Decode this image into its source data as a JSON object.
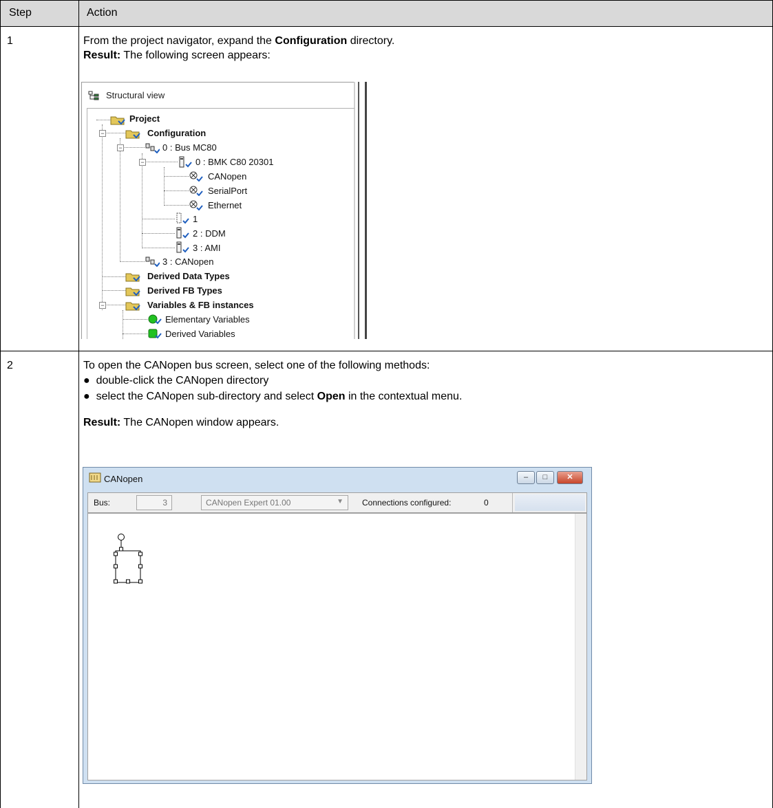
{
  "table": {
    "headers": {
      "step": "Step",
      "action": "Action"
    },
    "rows": [
      {
        "step": "1",
        "line1": {
          "pre": "From the project navigator, expand the ",
          "bold": "Configuration",
          "post": " directory."
        },
        "result": {
          "label": "Result:",
          "text": " The following screen appears:"
        }
      },
      {
        "step": "2",
        "intro": "To open the CANopen bus screen, select one of the following methods:",
        "bullet1": "double-click the CANopen directory",
        "bullet2": {
          "pre": "select the CANopen sub-directory and select ",
          "bold": "Open",
          "post": " in the contextual menu."
        },
        "result": {
          "label": "Result:",
          "text": " The CANopen window appears."
        }
      }
    ]
  },
  "structural_view": {
    "title": "Structural view",
    "nodes": {
      "project": "Project",
      "configuration": "Configuration",
      "bus": "0 : Bus MC80",
      "cpu": "0 : BMK C80 20301",
      "canopen_port": "CANopen",
      "serial_port": "SerialPort",
      "ethernet": "Ethernet",
      "slot1": "1",
      "ddm": "2 : DDM",
      "ami": "3 : AMI",
      "canopen_bus": "3 : CANopen",
      "derived_data_types": "Derived Data Types",
      "derived_fb_types": "Derived FB Types",
      "variables": "Variables & FB instances",
      "elementary": "Elementary Variables",
      "derived_vars": "Derived Variables"
    },
    "icons": [
      "tree-view-icon",
      "folder-icon",
      "bus-icon",
      "module-icon",
      "port-icon",
      "slot-icon",
      "green-variable-icon"
    ]
  },
  "canopen_window": {
    "title": "CANopen",
    "bus_label": "Bus:",
    "bus_value": "3",
    "device": "CANopen Expert  01.00",
    "connections_label": "Connections configured:",
    "connections_value": "0",
    "buttons": {
      "minimize": "–",
      "maximize": "□",
      "close": "✕"
    },
    "colors": {
      "title_bar": "#cfe0f1",
      "close_button": "#c7452a"
    }
  }
}
